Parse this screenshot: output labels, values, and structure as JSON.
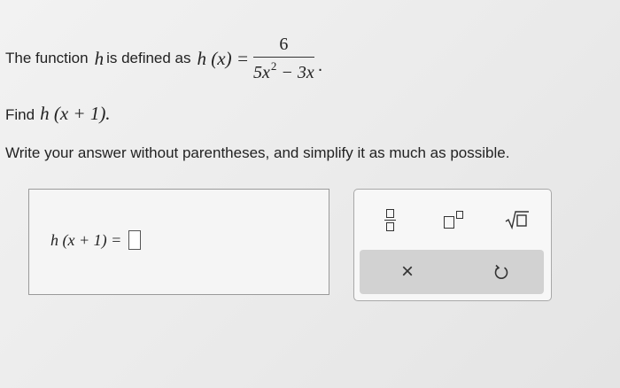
{
  "problem": {
    "intro_text": "The function",
    "fn_name": "h",
    "defined_as_text": "is defined as",
    "lhs": "h (x) =",
    "numerator": "6",
    "denominator_base": "5x",
    "denominator_exponent": "2",
    "denominator_rest": " − 3x",
    "end_punct": ".",
    "find_label": "Find",
    "find_expr": "h (x + 1).",
    "instruction": "Write your answer without parentheses, and simplify it as much as possible."
  },
  "answer": {
    "lhs": "h (x + 1) ="
  },
  "palette": {
    "fraction_icon": "fraction-icon",
    "superscript_icon": "superscript-icon",
    "sqrt_icon": "square-root-icon",
    "clear_label": "×",
    "undo_icon": "undo-icon"
  }
}
